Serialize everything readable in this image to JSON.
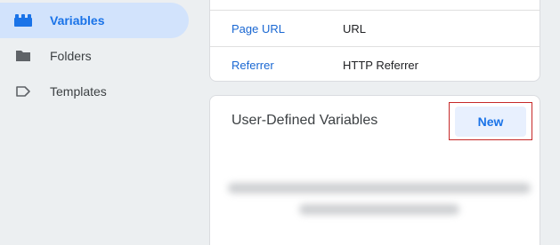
{
  "sidebar": {
    "items": [
      {
        "label": "Variables",
        "icon": "blocks-icon",
        "active": true
      },
      {
        "label": "Folders",
        "icon": "folder-icon",
        "active": false
      },
      {
        "label": "Templates",
        "icon": "tag-icon",
        "active": false
      }
    ]
  },
  "builtin_variables": {
    "rows": [
      {
        "name": "Page URL",
        "type": "URL"
      },
      {
        "name": "Referrer",
        "type": "HTTP Referrer"
      }
    ]
  },
  "user_defined": {
    "title": "User-Defined Variables",
    "new_label": "New"
  },
  "colors": {
    "accent": "#1a73e8",
    "active_bg": "#d2e3fc",
    "highlight_border": "#c62828",
    "page_bg": "#eceff1"
  }
}
